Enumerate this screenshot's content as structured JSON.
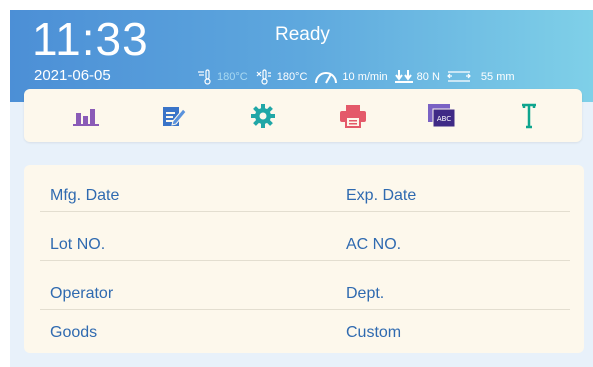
{
  "header": {
    "time": "11:33",
    "date": "2021-06-05",
    "status": "Ready",
    "readouts": {
      "temp1": "180°C",
      "temp2": "180°C",
      "speed": "10 m/min",
      "force": "80 N",
      "width": "55 mm"
    }
  },
  "toolbar": {
    "buttons": [
      {
        "name": "bar-chart-icon",
        "color": "#8a5bb7"
      },
      {
        "name": "edit-document-icon",
        "color": "#3a74c8"
      },
      {
        "name": "gear-icon",
        "color": "#20a7a7"
      },
      {
        "name": "printer-icon",
        "color": "#e45a6a"
      },
      {
        "name": "abc-label-icon",
        "color": "#5b3aa3"
      },
      {
        "name": "text-t-icon",
        "color": "#0fa58e"
      }
    ]
  },
  "fields": {
    "mfg_date": "Mfg. Date",
    "exp_date": "Exp. Date",
    "lot_no": "Lot NO.",
    "ac_no": "AC NO.",
    "operator": "Operator",
    "dept": "Dept.",
    "goods": "Goods",
    "custom": "Custom"
  }
}
